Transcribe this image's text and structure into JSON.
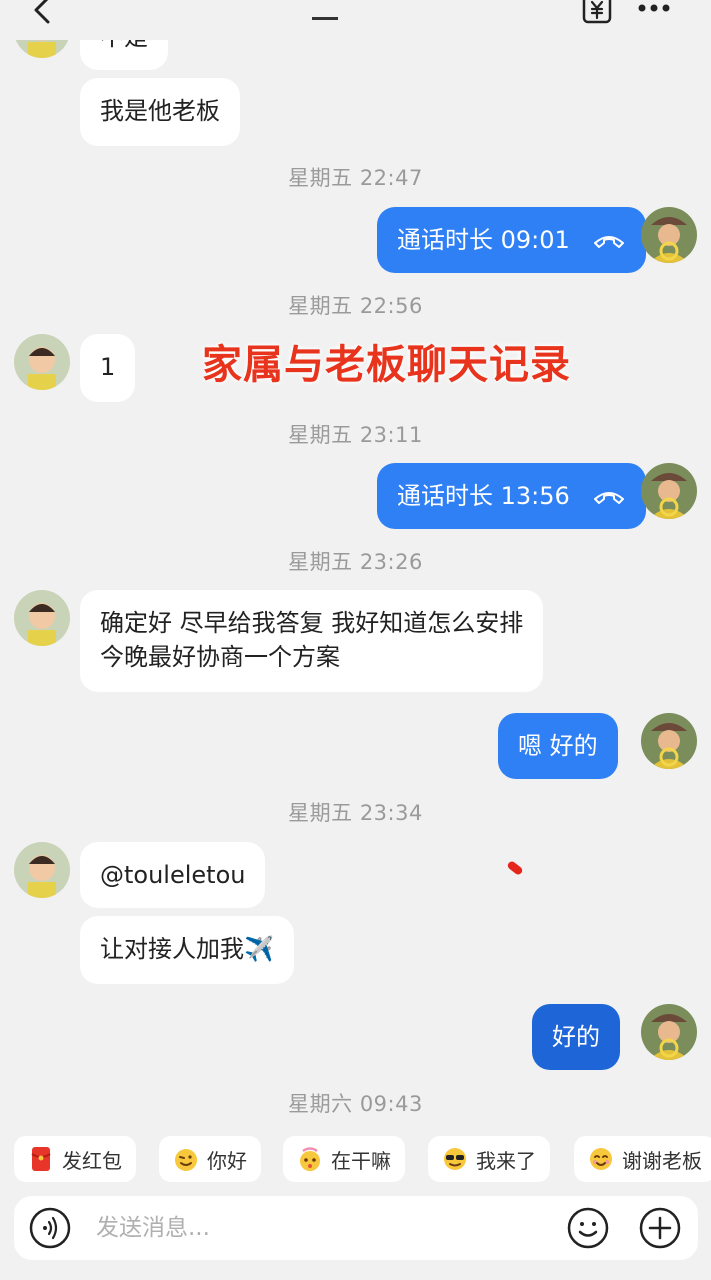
{
  "messages": {
    "partial_text": "不是",
    "m1": "我是他老板",
    "t1": "星期五 22:47",
    "call1": "通话时长 09:01",
    "t2": "星期五 22:56",
    "m2": "1",
    "t3": "星期五 23:11",
    "call2": "通话时长 13:56",
    "t4": "星期五 23:26",
    "m3_line1": "确定好 尽早给我答复 我好知道怎么安排",
    "m3_line2": "今晚最好协商一个方案",
    "m4": "嗯 好的",
    "t5": "星期五 23:34",
    "m5": "@touleletou",
    "m6": "让对接人加我✈️",
    "m7": "好的",
    "t6": "星期六 09:43"
  },
  "overlay_text": "家属与老板聊天记录",
  "quick_replies": [
    {
      "label": "发红包",
      "icon": "red-envelope-icon"
    },
    {
      "label": "你好",
      "icon": "wink-emoji-icon"
    },
    {
      "label": "在干嘛",
      "icon": "curious-emoji-icon"
    },
    {
      "label": "我来了",
      "icon": "sunglasses-emoji-icon"
    },
    {
      "label": "谢谢老板",
      "icon": "thanks-emoji-icon"
    }
  ],
  "input": {
    "placeholder": "发送消息..."
  },
  "colors": {
    "bubble_out": "#2f7ff5",
    "bubble_out_dark": "#1e66d8",
    "bubble_in": "#ffffff",
    "background": "#f1f1f1",
    "overlay": "#e8341c"
  }
}
